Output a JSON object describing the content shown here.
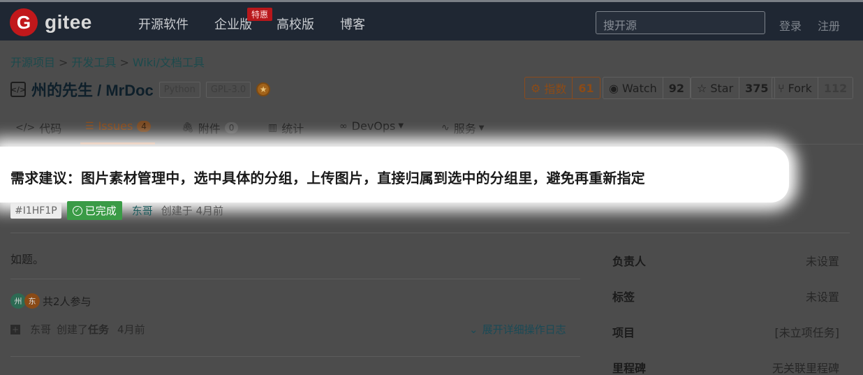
{
  "nav": {
    "logo_mark": "G",
    "logo_text": "gitee",
    "links": [
      "开源软件",
      "企业版",
      "高校版",
      "博客"
    ],
    "hot_badge": "特惠",
    "search_placeholder": "搜开源",
    "login": "登录",
    "register": "注册"
  },
  "breadcrumb": [
    "开源项目",
    "开发工具",
    "Wiki/文档工具"
  ],
  "breadcrumb_sep": ">",
  "project": {
    "icon": "</>",
    "name": "州的先生 / MrDoc",
    "tags": [
      "Python",
      "GPL-3.0"
    ]
  },
  "stats": {
    "index": {
      "label": "指数",
      "count": "61"
    },
    "watch": {
      "label": "Watch",
      "count": "92"
    },
    "star": {
      "label": "Star",
      "count": "375"
    },
    "fork": {
      "label": "Fork",
      "count": "112"
    }
  },
  "tabs": [
    {
      "label": "代码",
      "icon": "code-icon"
    },
    {
      "label": "Issues",
      "count": "4",
      "icon": "issues-icon"
    },
    {
      "label": "附件",
      "count": "0",
      "icon": "attachment-icon"
    },
    {
      "label": "统计",
      "icon": "stats-icon"
    },
    {
      "label": "DevOps",
      "icon": "devops-icon"
    },
    {
      "label": "服务",
      "icon": "service-icon"
    }
  ],
  "issue": {
    "title": "需求建议：图片素材管理中，选中具体的分组，上传图片，直接归属到选中的分组里，避免再重新指定",
    "id": "#I1HF1P",
    "status": "已完成",
    "author": "东哥",
    "created": "创建于 4月前",
    "body": "如题。",
    "participants_text": "共2人参与",
    "avatar1": "州",
    "avatar2": "东",
    "activity": {
      "who": "东哥",
      "action": "创建了",
      "object": "任务",
      "when": "4月前"
    },
    "expand_label": "展开详细操作日志"
  },
  "sidebar": [
    {
      "key": "负责人",
      "value": "未设置"
    },
    {
      "key": "标签",
      "value": "未设置"
    },
    {
      "key": "项目",
      "value": "[未立项任务]"
    },
    {
      "key": "里程碑",
      "value": "无关联里程碑"
    }
  ],
  "colors": {
    "topbar": "#1f2733",
    "accent_orange": "#b0561a",
    "status_green": "#3a9b46"
  }
}
